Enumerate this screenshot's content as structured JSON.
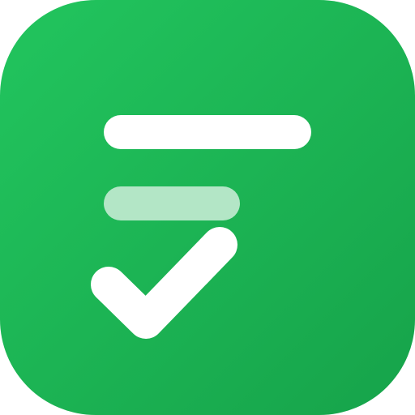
{
  "icon": {
    "name": "task-list-app-icon",
    "symbol": "checklist-icon",
    "colors": {
      "background_top_left": "#22C55E",
      "background_bottom_right": "#16A34A",
      "primary_line": "#FFFFFF",
      "secondary_line": "#B3E6C6",
      "checkmark": "#FFFFFF"
    }
  }
}
